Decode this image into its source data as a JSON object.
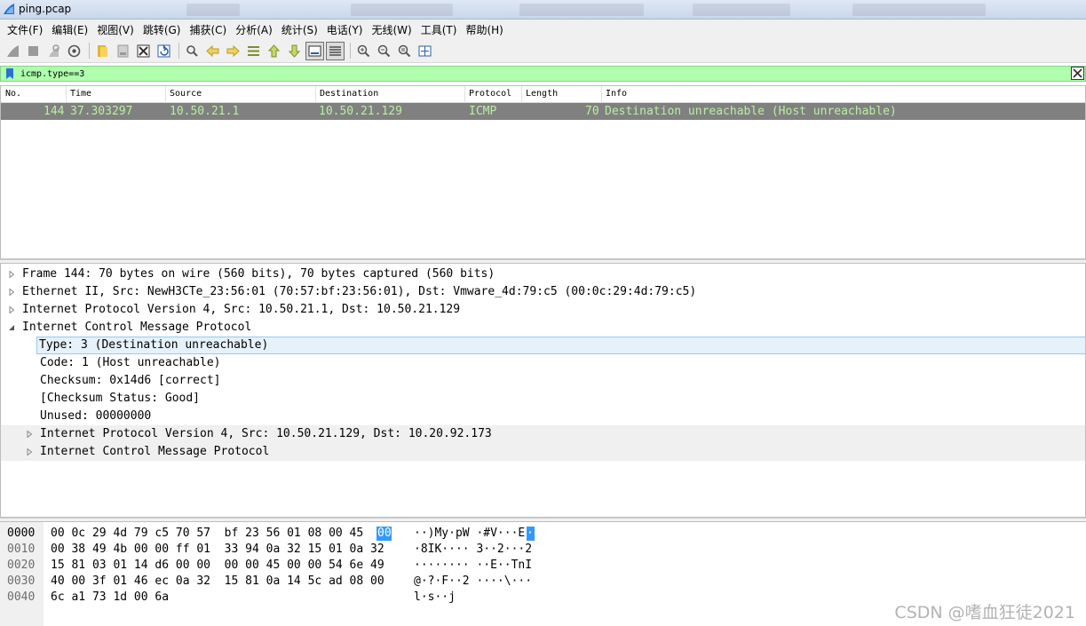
{
  "window": {
    "title": "ping.pcap"
  },
  "menu": [
    "文件(F)",
    "编辑(E)",
    "视图(V)",
    "跳转(G)",
    "捕获(C)",
    "分析(A)",
    "统计(S)",
    "电话(Y)",
    "无线(W)",
    "工具(T)",
    "帮助(H)"
  ],
  "toolbar": {
    "icons": [
      "start-capture-icon",
      "stop-capture-icon",
      "restart-capture-icon",
      "capture-options-icon",
      "open-file-icon",
      "save-file-icon",
      "close-file-icon",
      "reload-file-icon",
      "find-packet-icon",
      "go-back-icon",
      "go-forward-icon",
      "go-to-packet-icon",
      "first-packet-icon",
      "last-packet-icon",
      "auto-scroll-icon",
      "colorize-icon",
      "zoom-in-icon",
      "zoom-out-icon",
      "normal-size-icon",
      "resize-columns-icon"
    ]
  },
  "filter": {
    "value": "icmp.type==3"
  },
  "packet_list": {
    "columns": [
      "No.",
      "Time",
      "Source",
      "Destination",
      "Protocol",
      "Length",
      "Info"
    ],
    "rows": [
      {
        "no": "144",
        "time": "37.303297",
        "source": "10.50.21.1",
        "destination": "10.50.21.129",
        "protocol": "ICMP",
        "length": "70",
        "info": "Destination unreachable (Host unreachable)"
      }
    ]
  },
  "details": [
    {
      "text": "Frame 144: 70 bytes on wire (560 bits), 70 bytes captured (560 bits)",
      "state": "collapsed",
      "level": 0
    },
    {
      "text": "Ethernet II, Src: NewH3CTe_23:56:01 (70:57:bf:23:56:01), Dst: Vmware_4d:79:c5 (00:0c:29:4d:79:c5)",
      "state": "collapsed",
      "level": 0
    },
    {
      "text": "Internet Protocol Version 4, Src: 10.50.21.1, Dst: 10.50.21.129",
      "state": "collapsed",
      "level": 0
    },
    {
      "text": "Internet Control Message Protocol",
      "state": "expanded",
      "level": 0
    },
    {
      "text": "Type: 3 (Destination unreachable)",
      "state": "leaf",
      "level": 1,
      "selected": true
    },
    {
      "text": "Code: 1 (Host unreachable)",
      "state": "leaf",
      "level": 1
    },
    {
      "text": "Checksum: 0x14d6 [correct]",
      "state": "leaf",
      "level": 1
    },
    {
      "text": "[Checksum Status: Good]",
      "state": "leaf",
      "level": 1
    },
    {
      "text": "Unused: 00000000",
      "state": "leaf",
      "level": 1
    },
    {
      "text": "Internet Protocol Version 4, Src: 10.50.21.129, Dst: 10.20.92.173",
      "state": "collapsed",
      "level": 1,
      "shaded": true
    },
    {
      "text": "Internet Control Message Protocol",
      "state": "collapsed",
      "level": 1,
      "shaded": true
    }
  ],
  "bytes": [
    {
      "offset": "0000",
      "hex": "00 0c 29 4d 79 c5 70 57  bf 23 56 01 08 00 45 ",
      "hex_hl": "00",
      "ascii": "··)My·pW ·#V···E",
      "ascii_hl": "·"
    },
    {
      "offset": "0010",
      "hex": "00 38 49 4b 00 00 ff 01  33 94 0a 32 15 01 0a 32",
      "ascii": "·8IK···· 3··2···2"
    },
    {
      "offset": "0020",
      "hex": "15 81 03 01 14 d6 00 00  00 00 45 00 00 54 6e 49",
      "ascii": "········ ··E··TnI"
    },
    {
      "offset": "0030",
      "hex": "40 00 3f 01 46 ec 0a 32  15 81 0a 14 5c ad 08 00",
      "ascii": "@·?·F··2 ····\\···"
    },
    {
      "offset": "0040",
      "hex": "6c a1 73 1d 00 6a",
      "ascii": "l·s··j"
    }
  ],
  "watermark": "CSDN @嗜血狂徒2021",
  "colors": {
    "filter_valid_bg": "#afffaf",
    "row_bg": "#808080",
    "row_fg": "#b8f0a0",
    "selection": "#3399ff"
  }
}
